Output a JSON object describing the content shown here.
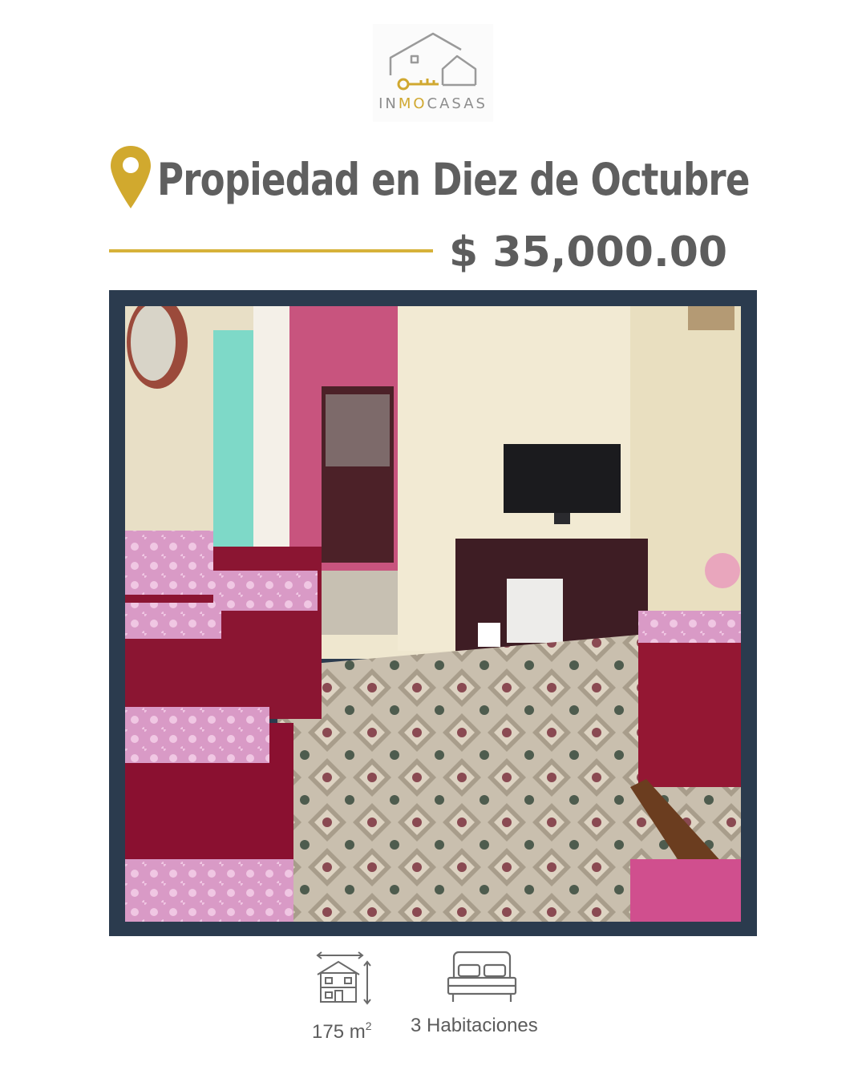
{
  "brand": {
    "name_prefix": "IN",
    "name_highlight": "MO",
    "name_suffix": "CASAS",
    "primary_color": "#8d8d8d",
    "accent_color": "#d0a830",
    "icon": "house-key-logo-icon"
  },
  "listing": {
    "title": "Propiedad en Diez de Octubre",
    "price": "$ 35,000.00",
    "location_icon": "map-pin-icon",
    "photo": "living-room-photo"
  },
  "features": {
    "area_value": "175 m",
    "area_sup": "2",
    "area_icon": "house-area-icon",
    "rooms": "3 Habitaciones",
    "rooms_icon": "bed-icon"
  },
  "colors": {
    "frame": "#2b3b4e",
    "rule": "#d6b23a",
    "pin": "#d1a92e",
    "title": "#5f5f5f"
  }
}
